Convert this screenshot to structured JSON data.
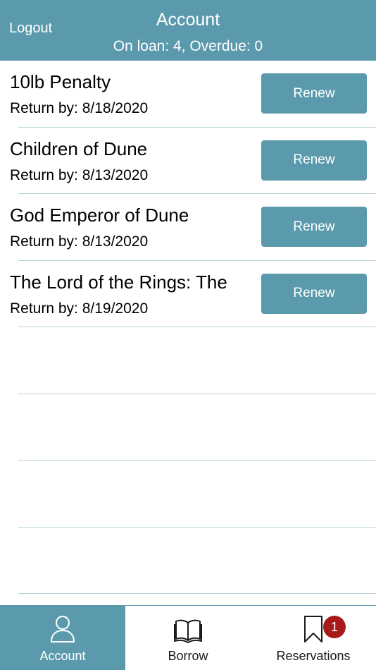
{
  "header": {
    "logout_label": "Logout",
    "title": "Account",
    "subtitle": "On loan: 4, Overdue: 0"
  },
  "loans": [
    {
      "title": "10lb Penalty",
      "return_by": "Return by: 8/18/2020",
      "action": "Renew"
    },
    {
      "title": "Children of Dune",
      "return_by": "Return by: 8/13/2020",
      "action": "Renew"
    },
    {
      "title": "God Emperor of Dune",
      "return_by": "Return by: 8/13/2020",
      "action": "Renew"
    },
    {
      "title": "The Lord of the Rings: The",
      "return_by": "Return by: 8/19/2020",
      "action": "Renew"
    }
  ],
  "tabbar": {
    "tabs": [
      {
        "label": "Account",
        "icon": "person-icon",
        "active": true
      },
      {
        "label": "Borrow",
        "icon": "book-icon",
        "active": false
      },
      {
        "label": "Reservations",
        "icon": "bookmark-icon",
        "active": false,
        "badge": "1"
      }
    ]
  },
  "colors": {
    "accent": "#5b9aac",
    "badge": "#a81a1a",
    "separator": "#b7d2da"
  }
}
